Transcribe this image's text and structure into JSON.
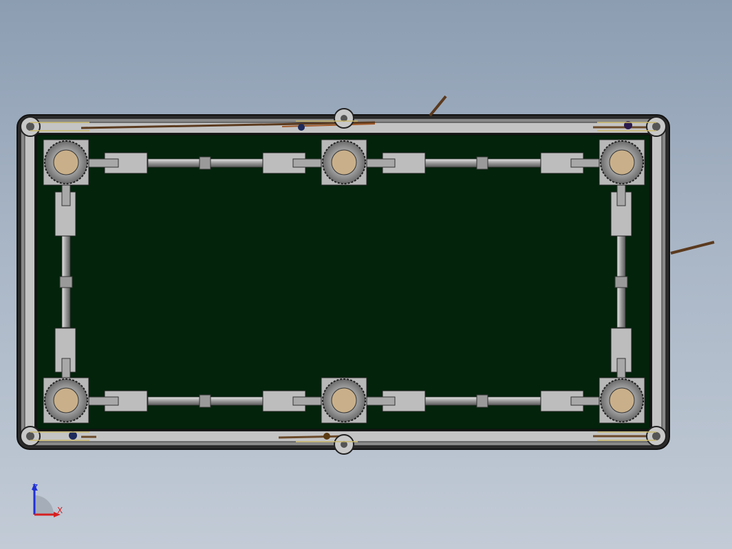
{
  "viewport": {
    "background_top": "#8c9db2",
    "background_bottom": "#c2cbd6"
  },
  "model": {
    "felt_color": "#03230b",
    "frame_color": "#b4b4b4",
    "pocket_count": 6,
    "motor_color": "#c9b08a"
  },
  "triad": {
    "z_label": "Z",
    "x_label": "X",
    "z_color": "#1f2fd6",
    "x_color": "#d61f1f"
  }
}
